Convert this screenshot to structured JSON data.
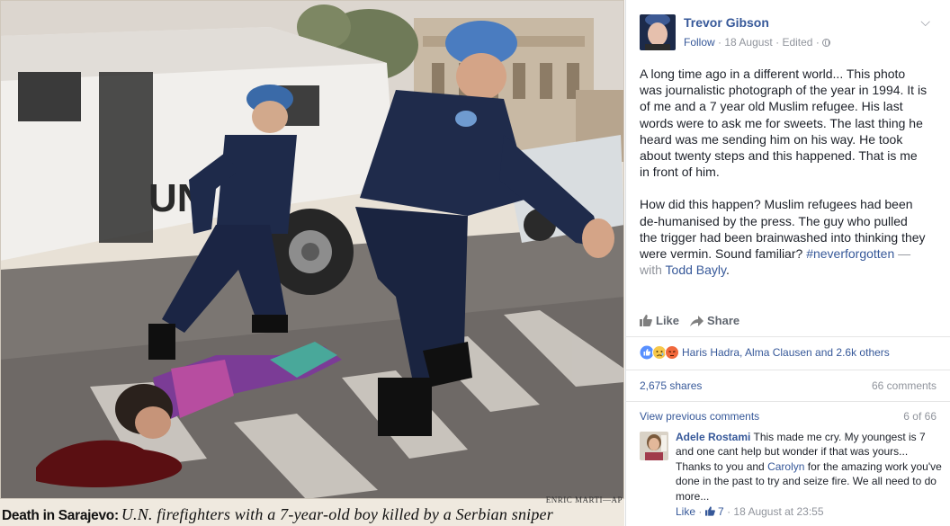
{
  "photo": {
    "credit": "ENRIC MARTI—AP",
    "caption_bold": "Death in Sarajevo:",
    "caption_italic": "U.N. firefighters with a 7-year-old boy killed by a Serbian sniper",
    "truck_lettering": "UN"
  },
  "post": {
    "author": "Trevor Gibson",
    "follow_label": "Follow",
    "date": "18 August",
    "edited_label": "Edited",
    "paragraph1": "A long time ago in a different world... This photo was journalistic photograph of the year in 1994. It is of me and a 7 year old Muslim refugee. His last words were to ask me for sweets. The last thing he heard was me sending him on his way. He took about twenty steps and this happened. That is me in front of him.",
    "paragraph2_text": "How did this happen? Muslim refugees had been de-humanised by the press. The guy who pulled the trigger had been brainwashed into thinking they were vermin. Sound familiar?",
    "hashtag": "#neverforgotten",
    "with_label": "— with",
    "tagged_person": "Todd Bayly"
  },
  "actions": {
    "like_label": "Like",
    "share_label": "Share"
  },
  "reactions": {
    "summary": "Haris Hadra, Alma Clausen and 2.6k others",
    "icons": [
      "like-icon",
      "sad-icon",
      "angry-icon"
    ]
  },
  "stats": {
    "shares": "2,675 shares",
    "comments": "66 comments"
  },
  "comments_section": {
    "view_previous_label": "View previous comments",
    "pager": "6 of 66",
    "comment": {
      "author": "Adele Rostami",
      "text_part1": "This made me cry. My youngest is 7 and one cant help but wonder if that was yours... Thanks to you and",
      "mention": "Carolyn",
      "text_part2": "for the amazing work you've done in the past to try and seize fire. We all need to do more...",
      "like_label": "Like",
      "like_count": "7",
      "timestamp": "18 August at 23:55"
    }
  },
  "colors": {
    "link_blue": "#365899",
    "muted_gray": "#90949c",
    "divider": "#e5e5e5"
  }
}
